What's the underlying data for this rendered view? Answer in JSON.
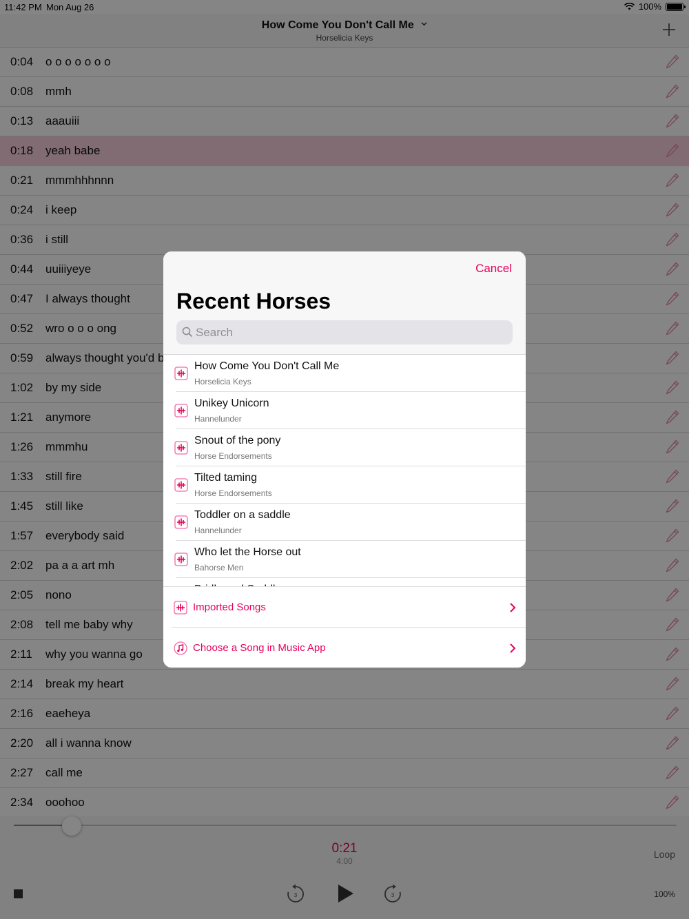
{
  "status_bar": {
    "time": "11:42 PM",
    "date": "Mon Aug 26",
    "battery": "100%"
  },
  "nav": {
    "title": "How Come You Don't Call Me",
    "subtitle": "Horselicia Keys"
  },
  "lyrics": [
    {
      "time": "0:04",
      "text": "o o o o o o o"
    },
    {
      "time": "0:08",
      "text": "mmh"
    },
    {
      "time": "0:13",
      "text": "aaauiii"
    },
    {
      "time": "0:18",
      "text": "yeah babe",
      "active": true
    },
    {
      "time": "0:21",
      "text": "mmmhhhnnn"
    },
    {
      "time": "0:24",
      "text": "i keep"
    },
    {
      "time": "0:36",
      "text": "i still"
    },
    {
      "time": "0:44",
      "text": "uuiiiyeye"
    },
    {
      "time": "0:47",
      "text": "I always thought"
    },
    {
      "time": "0:52",
      "text": "wro o o o ong"
    },
    {
      "time": "0:59",
      "text": "always thought you'd b"
    },
    {
      "time": "1:02",
      "text": "by my side"
    },
    {
      "time": "1:21",
      "text": "anymore"
    },
    {
      "time": "1:26",
      "text": "mmmhu"
    },
    {
      "time": "1:33",
      "text": "still fire"
    },
    {
      "time": "1:45",
      "text": "still like"
    },
    {
      "time": "1:57",
      "text": "everybody said"
    },
    {
      "time": "2:02",
      "text": "pa a a art mh"
    },
    {
      "time": "2:05",
      "text": "nono"
    },
    {
      "time": "2:08",
      "text": "tell me baby why"
    },
    {
      "time": "2:11",
      "text": "why you wanna go"
    },
    {
      "time": "2:14",
      "text": "break my heart"
    },
    {
      "time": "2:16",
      "text": "eaeheya"
    },
    {
      "time": "2:20",
      "text": "all i wanna know"
    },
    {
      "time": "2:27",
      "text": "call me"
    },
    {
      "time": "2:34",
      "text": "ooohoo"
    }
  ],
  "player": {
    "current": "0:21",
    "duration": "4:00",
    "progress": 0.0875,
    "loop": "Loop",
    "rate": "100%",
    "skip_seconds": "3"
  },
  "modal": {
    "cancel": "Cancel",
    "title": "Recent Horses",
    "search_placeholder": "Search",
    "songs": [
      {
        "title": "How Come You Don't Call Me",
        "artist": "Horselicia Keys"
      },
      {
        "title": "Unikey Unicorn",
        "artist": "Hannelunder"
      },
      {
        "title": "Snout of the pony",
        "artist": "Horse Endorsements"
      },
      {
        "title": "Tilted taming",
        "artist": "Horse Endorsements"
      },
      {
        "title": "Toddler on a saddle",
        "artist": "Hannelunder"
      },
      {
        "title": "Who let the Horse out",
        "artist": "Bahorse Men"
      },
      {
        "title": "Bridle and Saddle",
        "artist": ""
      }
    ],
    "links": [
      {
        "label": "Imported Songs",
        "icon": "waveform-icon"
      },
      {
        "label": "Choose a Song in Music App",
        "icon": "music-note-icon"
      }
    ]
  },
  "colors": {
    "accent": "#e6005c",
    "active_row": "#f7d0dd",
    "overlay": "rgba(0,0,0,0.48)"
  }
}
